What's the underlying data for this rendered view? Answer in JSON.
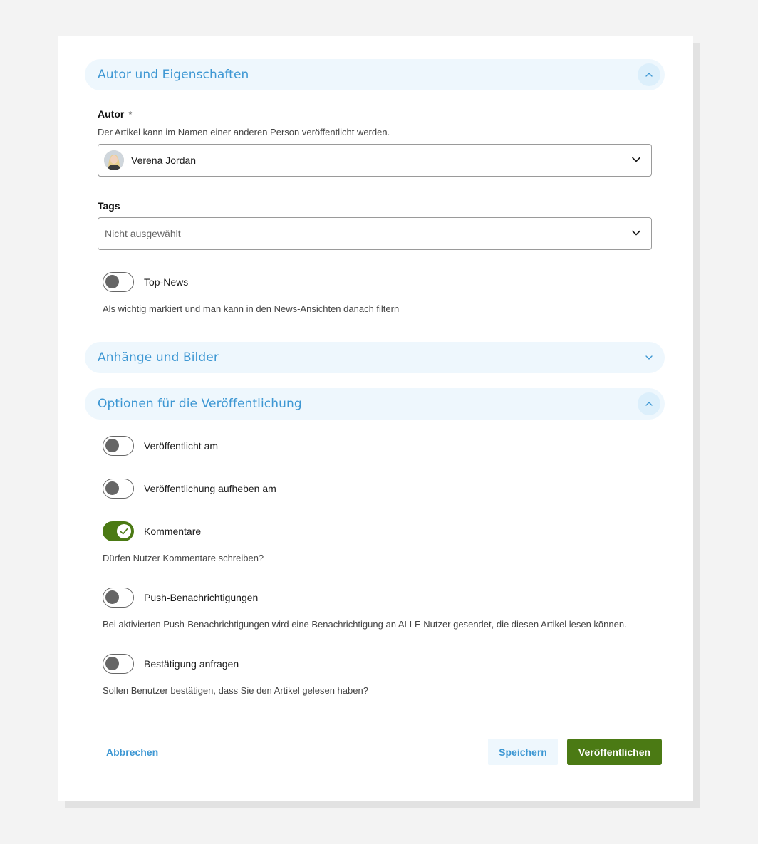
{
  "colors": {
    "accent": "#3d97d3",
    "section_bg": "#eef7fd",
    "primary": "#4b7a14",
    "toggle_off": "#666666"
  },
  "sections": {
    "author": {
      "title": "Autor und Eigenschaften",
      "expanded": true,
      "chevron_icon": "chevron-up-icon"
    },
    "attachments": {
      "title": "Anhänge und Bilder",
      "expanded": false,
      "chevron_icon": "chevron-down-icon"
    },
    "publishing": {
      "title": "Optionen für die Veröffentlichung",
      "expanded": true,
      "chevron_icon": "chevron-up-icon"
    }
  },
  "author_field": {
    "label": "Autor",
    "required_mark": "*",
    "help": "Der Artikel kann im Namen einer anderen Person veröffentlicht werden.",
    "value": "Verena Jordan",
    "avatar_icon": "user-avatar"
  },
  "tags_field": {
    "label": "Tags",
    "placeholder": "Nicht ausgewählt"
  },
  "top_news": {
    "label": "Top-News",
    "on": false,
    "help": "Als wichtig markiert und man kann in den News-Ansichten danach filtern"
  },
  "publish_options": {
    "published_at": {
      "label": "Veröffentlicht am",
      "on": false
    },
    "unpublish_at": {
      "label": "Veröffentlichung aufheben am",
      "on": false
    },
    "comments": {
      "label": "Kommentare",
      "on": true,
      "help": "Dürfen Nutzer Kommentare schreiben?"
    },
    "push": {
      "label": "Push-Benachrichtigungen",
      "on": false,
      "help": "Bei aktivierten Push-Benachrichtigungen wird eine Benachrichtigung an ALLE Nutzer gesendet, die diesen Artikel lesen können."
    },
    "confirm": {
      "label": "Bestätigung anfragen",
      "on": false,
      "help": "Sollen Benutzer bestätigen, dass Sie den Artikel gelesen haben?"
    }
  },
  "actions": {
    "cancel": "Abbrechen",
    "save": "Speichern",
    "publish": "Veröffentlichen"
  }
}
